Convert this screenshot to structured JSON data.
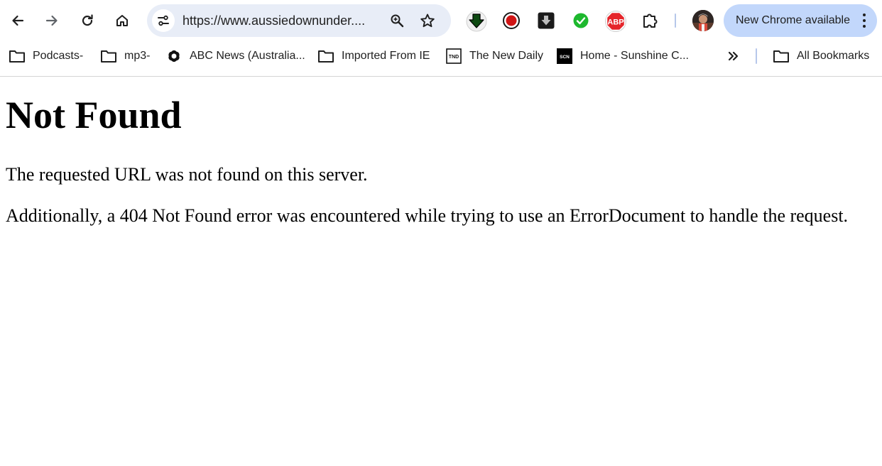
{
  "toolbar": {
    "back_icon": "arrow-left-icon",
    "forward_icon": "arrow-right-icon",
    "reload_icon": "reload-icon",
    "home_icon": "home-icon"
  },
  "omnibox": {
    "url": "https://www.aussiedownunder....",
    "site_info_icon": "tune-icon",
    "zoom_icon": "zoom-icon",
    "bookmark_icon": "star-icon"
  },
  "extensions": [
    {
      "name": "download-arrow-extension-icon"
    },
    {
      "name": "record-extension-icon"
    },
    {
      "name": "download-box-extension-icon"
    },
    {
      "name": "check-extension-icon"
    },
    {
      "name": "adblock-plus-extension-icon",
      "text": "ABP"
    },
    {
      "name": "puzzle-extensions-icon"
    }
  ],
  "update": {
    "label": "New Chrome available"
  },
  "bookmarks": {
    "items": [
      {
        "label": "Podcasts-",
        "icon": "folder-icon"
      },
      {
        "label": "mp3-",
        "icon": "folder-icon"
      },
      {
        "label": "ABC News (Australia...",
        "icon": "abc-logo-icon"
      },
      {
        "label": "Imported From IE",
        "icon": "folder-icon"
      },
      {
        "label": "The New Daily",
        "icon": "tnd-logo-icon",
        "badge": "TND"
      },
      {
        "label": "Home - Sunshine C...",
        "icon": "scn-logo-icon",
        "badge": "SCN"
      }
    ],
    "all_label": "All Bookmarks"
  },
  "colors": {
    "omnibox_bg": "#e8edf7",
    "update_bg": "#c2d7fb",
    "divider": "#b6c7ea",
    "text": "#1f1f1f"
  },
  "page": {
    "heading": "Not Found",
    "message": "The requested URL was not found on this server.",
    "detail": "Additionally, a 404 Not Found error was encountered while trying to use an ErrorDocument to handle the request."
  }
}
